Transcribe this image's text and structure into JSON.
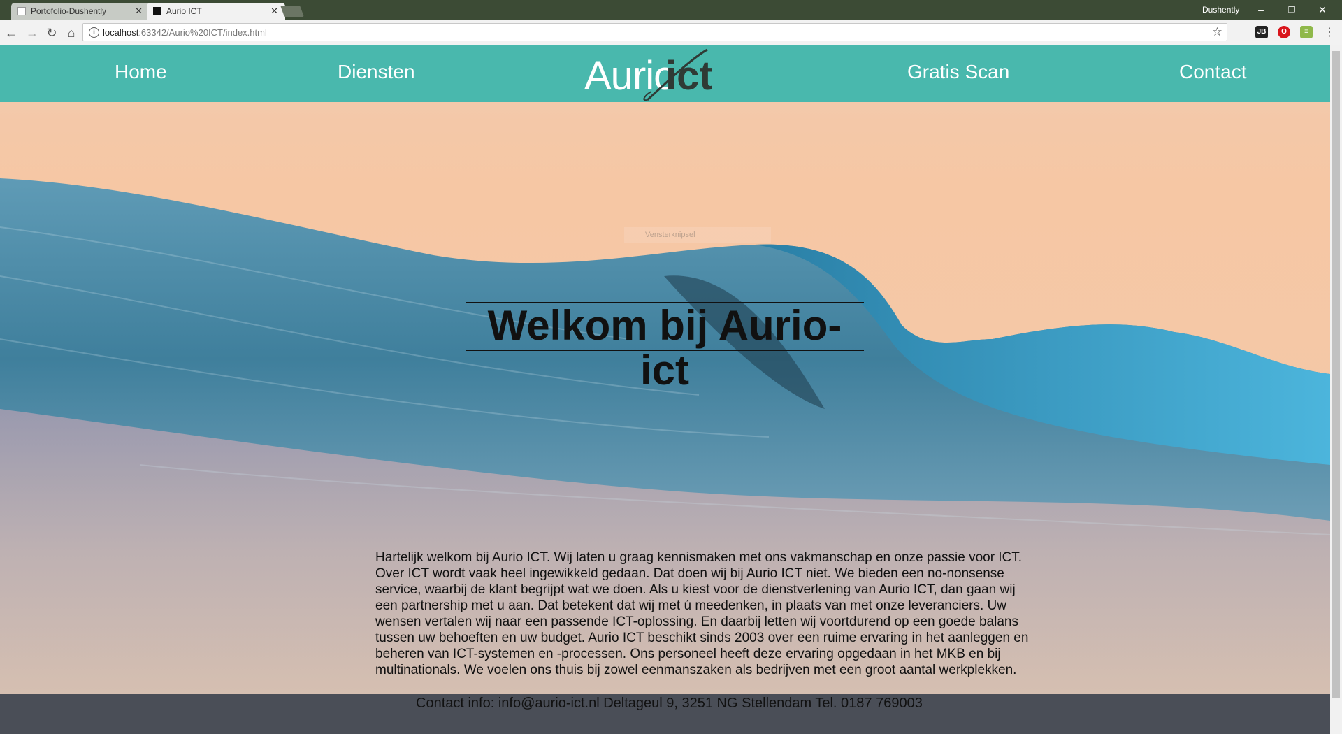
{
  "browser": {
    "tabs": [
      {
        "label": "Portofolio-Dushently",
        "close": "✕"
      },
      {
        "label": "Aurio ICT",
        "close": "✕"
      }
    ],
    "user": "Dushently",
    "window_controls": {
      "minimize": "–",
      "restore": "❐",
      "close": "✕"
    },
    "address": {
      "host": "localhost",
      "rest": ":63342/Aurio%20ICT/index.html"
    },
    "colors": {
      "tabbar": "#3c4b35",
      "toolbar": "#f2f2f2"
    }
  },
  "site": {
    "nav": [
      {
        "label": "Home"
      },
      {
        "label": "Diensten"
      },
      {
        "label": "Gratis Scan"
      },
      {
        "label": "Contact"
      }
    ],
    "logo": {
      "left": "Aurio",
      "right": "ict"
    },
    "heading": "Welkom bij Aurio-ict",
    "overlay_ghost": "Vensterknipsel",
    "intro": "Hartelijk welkom bij Aurio ICT. Wij laten u graag kennismaken met ons vakmanschap en onze passie voor ICT. Over ICT wordt vaak heel ingewikkeld gedaan. Dat doen wij bij Aurio ICT niet. We bieden een no-nonsense service, waarbij de klant begrijpt wat we doen. Als u kiest voor de dienstverlening van Aurio ICT, dan gaan wij een partnership met u aan. Dat betekent dat wij met ú meedenken, in plaats van met onze leveranciers. Uw wensen vertalen wij naar een passende ICT-oplossing. En daarbij letten wij voortdurend op een goede balans tussen uw behoeften en uw budget. Aurio ICT beschikt sinds 2003 over een ruime ervaring in het aanleggen en beheren van ICT-systemen en -processen. Ons personeel heeft deze ervaring opgedaan in het MKB en bij multinationals. We voelen ons thuis bij zowel eenmanszaken als bedrijven met een groot aantal werkplekken.",
    "contact": "Contact info: info@aurio-ict.nl Deltageul 9, 3251 NG Stellendam Tel. 0187 769003",
    "colors": {
      "nav": "#49b8ad",
      "footer": "#4a4e57",
      "nav_text": "#ffffff"
    }
  }
}
